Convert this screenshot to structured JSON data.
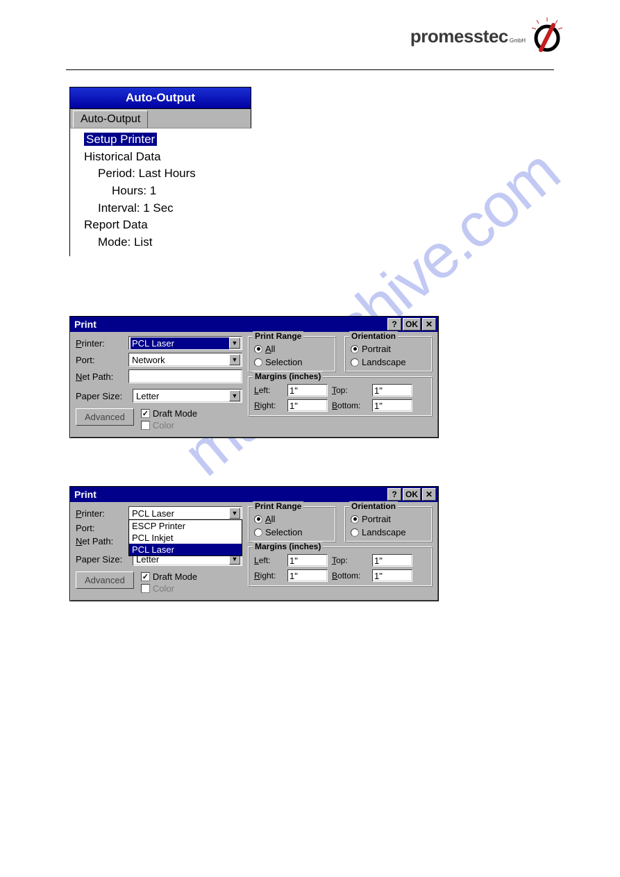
{
  "logo": {
    "text": "promesstec",
    "sub": "GmbH"
  },
  "watermark": "manualshive.com",
  "tree": {
    "title": "Auto-Output",
    "tab": "Auto-Output",
    "items": {
      "setup_printer": "Setup Printer",
      "historical": "Historical Data",
      "period": "Period: Last Hours",
      "hours": "Hours: 1",
      "interval": "Interval: 1 Sec",
      "report": "Report Data",
      "mode": "Mode: List"
    }
  },
  "dlg1": {
    "title": "Print",
    "help": "?",
    "ok": "OK",
    "close": "✕",
    "labels": {
      "printer": "Printer:",
      "port": "Port:",
      "netpath": "Net Path:",
      "paper": "Paper Size:",
      "advanced": "Advanced",
      "draft": "Draft Mode",
      "color": "Color"
    },
    "values": {
      "printer": "PCL Laser",
      "port": "Network",
      "netpath": "",
      "paper": "Letter"
    },
    "print_range": {
      "title": "Print Range",
      "all": "All",
      "selection": "Selection"
    },
    "orientation": {
      "title": "Orientation",
      "portrait": "Portrait",
      "landscape": "Landscape"
    },
    "margins": {
      "title": "Margins (inches)",
      "left_l": "Left:",
      "left_v": "1\"",
      "top_l": "Top:",
      "top_v": "1\"",
      "right_l": "Right:",
      "right_v": "1\"",
      "bottom_l": "Bottom:",
      "bottom_v": "1\""
    }
  },
  "dlg2": {
    "title": "Print",
    "help": "?",
    "ok": "OK",
    "close": "✕",
    "labels": {
      "printer": "Printer:",
      "port": "Port:",
      "netpath": "Net Path:",
      "paper": "Paper Size:",
      "advanced": "Advanced",
      "draft": "Draft Mode",
      "color": "Color"
    },
    "values": {
      "printer": "PCL Laser",
      "paper": "Letter"
    },
    "printer_options": [
      "ESCP Printer",
      "PCL Inkjet",
      "PCL Laser"
    ],
    "print_range": {
      "title": "Print Range",
      "all": "All",
      "selection": "Selection"
    },
    "orientation": {
      "title": "Orientation",
      "portrait": "Portrait",
      "landscape": "Landscape"
    },
    "margins": {
      "title": "Margins (inches)",
      "left_l": "Left:",
      "left_v": "1\"",
      "top_l": "Top:",
      "top_v": "1\"",
      "right_l": "Right:",
      "right_v": "1\"",
      "bottom_l": "Bottom:",
      "bottom_v": "1\""
    }
  }
}
